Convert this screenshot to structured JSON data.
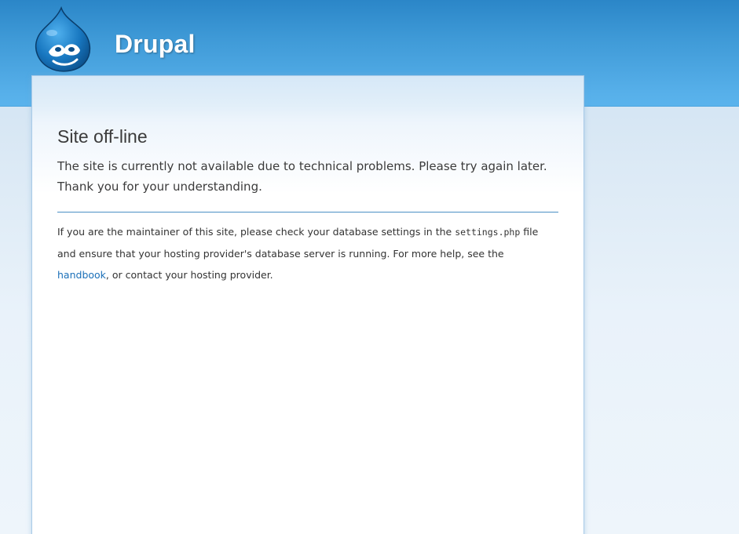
{
  "header": {
    "site_name": "Drupal",
    "logo_icon": "drupal-drop-logo-icon"
  },
  "main": {
    "title": "Site off-line",
    "message_line1": "The site is currently not available due to technical problems. Please try again later.",
    "message_line2": "Thank you for your understanding.",
    "help": {
      "part1": "If you are the maintainer of this site, please check your database settings in the ",
      "code_file": "settings.php",
      "part2": " file and ensure that your hosting provider's database server is running. For more help, see the ",
      "link_text": "handbook",
      "part3": ", or contact your hosting provider."
    }
  },
  "colors": {
    "header_blue": "#3f9ad7",
    "link_blue": "#1a6fb8",
    "divider_blue": "#4a90c4",
    "text": "#3b3b3b"
  }
}
